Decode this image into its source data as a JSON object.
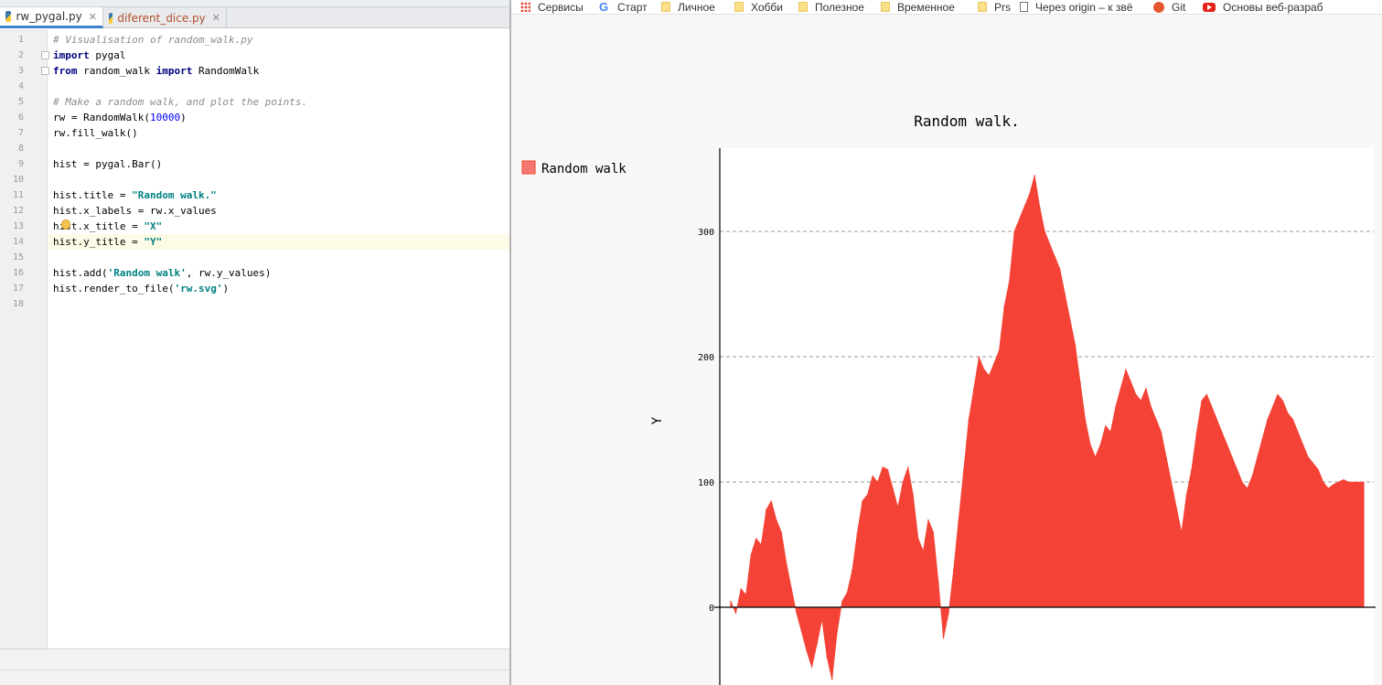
{
  "editor": {
    "tabs": [
      {
        "label": "rw_pygal.py",
        "active": true,
        "modified": false
      },
      {
        "label": "diferent_dice.py",
        "active": false,
        "modified": true
      }
    ],
    "line_numbers": [
      "1",
      "2",
      "3",
      "4",
      "5",
      "6",
      "7",
      "8",
      "9",
      "10",
      "11",
      "12",
      "13",
      "14",
      "15",
      "16",
      "17",
      "18"
    ],
    "current_line": 14,
    "code_lines": [
      [
        {
          "t": "cm",
          "s": "# Visualisation of random_walk.py"
        }
      ],
      [
        {
          "t": "kw",
          "s": "import"
        },
        {
          "t": "pl",
          "s": " pygal"
        }
      ],
      [
        {
          "t": "kw",
          "s": "from"
        },
        {
          "t": "pl",
          "s": " random_walk "
        },
        {
          "t": "kw",
          "s": "import"
        },
        {
          "t": "pl",
          "s": " RandomWalk"
        }
      ],
      [],
      [
        {
          "t": "cm",
          "s": "# Make a random walk, and plot the points."
        }
      ],
      [
        {
          "t": "pl",
          "s": "rw = RandomWalk("
        },
        {
          "t": "nm",
          "s": "10000"
        },
        {
          "t": "pl",
          "s": ")"
        }
      ],
      [
        {
          "t": "pl",
          "s": "rw.fill_walk()"
        }
      ],
      [],
      [
        {
          "t": "pl",
          "s": "hist = pygal.Bar()"
        }
      ],
      [],
      [
        {
          "t": "pl",
          "s": "hist.title = "
        },
        {
          "t": "st",
          "s": "\"Random walk.\""
        }
      ],
      [
        {
          "t": "pl",
          "s": "hist.x_labels = rw.x_values"
        }
      ],
      [
        {
          "t": "pl",
          "s": "hist.x_title = "
        },
        {
          "t": "st",
          "s": "\"X\""
        }
      ],
      [
        {
          "t": "pl",
          "s": "hist.y_title = "
        },
        {
          "t": "st",
          "s": "\"Y\""
        }
      ],
      [],
      [
        {
          "t": "pl",
          "s": "hist.add("
        },
        {
          "t": "st",
          "s": "'Random walk'"
        },
        {
          "t": "pl",
          "s": ", rw.y_values)"
        }
      ],
      [
        {
          "t": "pl",
          "s": "hist.render_to_file("
        },
        {
          "t": "st",
          "s": "'rw.svg'"
        },
        {
          "t": "pl",
          "s": ")"
        }
      ],
      []
    ]
  },
  "bookmarks": [
    {
      "label": "Сервисы",
      "icon": "apps-grid-icon"
    },
    {
      "label": "Старт",
      "icon": "google-icon"
    },
    {
      "label": "Личное",
      "icon": "folder-icon"
    },
    {
      "label": "Хобби",
      "icon": "folder-icon"
    },
    {
      "label": "Полезное",
      "icon": "folder-icon"
    },
    {
      "label": "Временное",
      "icon": "folder-icon"
    },
    {
      "label": "Prs",
      "icon": "folder-icon"
    },
    {
      "label": "Через origin – к звё",
      "icon": "page-icon"
    },
    {
      "label": "Git",
      "icon": "git-icon"
    },
    {
      "label": "Основы веб-разраб",
      "icon": "youtube-icon"
    }
  ],
  "chart_data": {
    "type": "bar",
    "title": "Random walk.",
    "ylabel": "Y",
    "xlabel": "",
    "ylim": [
      -60,
      365
    ],
    "yticks": [
      0,
      100,
      200,
      300
    ],
    "grid": "horizontal-dashed",
    "legend_position": "left",
    "color": "#f44336",
    "series": [
      {
        "name": "Random walk",
        "x": [
          0,
          80,
          160,
          240,
          320,
          400,
          480,
          560,
          640,
          720,
          800,
          880,
          960,
          1040,
          1120,
          1200,
          1280,
          1360,
          1440,
          1520,
          1600,
          1680,
          1760,
          1840,
          1920,
          2000,
          2080,
          2160,
          2240,
          2320,
          2400,
          2480,
          2560,
          2640,
          2720,
          2800,
          2880,
          2960,
          3040,
          3120,
          3200,
          3280,
          3360,
          3440,
          3520,
          3600,
          3680,
          3760,
          3840,
          3920,
          4000,
          4080,
          4160,
          4240,
          4320,
          4400,
          4480,
          4560,
          4640,
          4720,
          4800,
          4880,
          4960,
          5040,
          5120,
          5200,
          5280,
          5360,
          5440,
          5520,
          5600,
          5680,
          5760,
          5840,
          5920,
          6000,
          6080,
          6160,
          6240,
          6320,
          6400,
          6480,
          6560,
          6640,
          6720,
          6800,
          6880,
          6960,
          7040,
          7120,
          7200,
          7280,
          7360,
          7440,
          7520,
          7600,
          7680,
          7760,
          7840,
          7920,
          8000,
          8080,
          8160,
          8240,
          8320,
          8400,
          8480,
          8560,
          8640,
          8720,
          8800,
          8880,
          8960,
          9040,
          9120,
          9200,
          9280,
          9360,
          9440,
          9520,
          9600,
          9680,
          9760,
          9840,
          9920,
          9999
        ],
        "values": [
          5,
          -5,
          15,
          10,
          42,
          55,
          50,
          78,
          85,
          70,
          60,
          35,
          15,
          -5,
          -20,
          -35,
          -48,
          -30,
          -10,
          -40,
          -58,
          -20,
          5,
          12,
          30,
          60,
          85,
          90,
          105,
          100,
          112,
          110,
          95,
          80,
          100,
          112,
          90,
          55,
          45,
          70,
          60,
          20,
          -25,
          -5,
          30,
          70,
          110,
          150,
          175,
          200,
          190,
          185,
          195,
          205,
          240,
          260,
          300,
          310,
          320,
          330,
          345,
          320,
          300,
          290,
          280,
          270,
          250,
          230,
          210,
          180,
          150,
          130,
          120,
          130,
          145,
          140,
          160,
          175,
          190,
          180,
          170,
          165,
          175,
          160,
          150,
          140,
          120,
          100,
          80,
          60,
          90,
          110,
          140,
          165,
          170,
          160,
          150,
          140,
          130,
          120,
          110,
          100,
          95,
          105,
          120,
          135,
          150,
          160,
          170,
          165,
          155,
          150,
          140,
          130,
          120,
          115,
          110,
          100,
          95,
          98,
          100,
          102,
          100,
          100,
          100,
          100
        ]
      }
    ]
  }
}
